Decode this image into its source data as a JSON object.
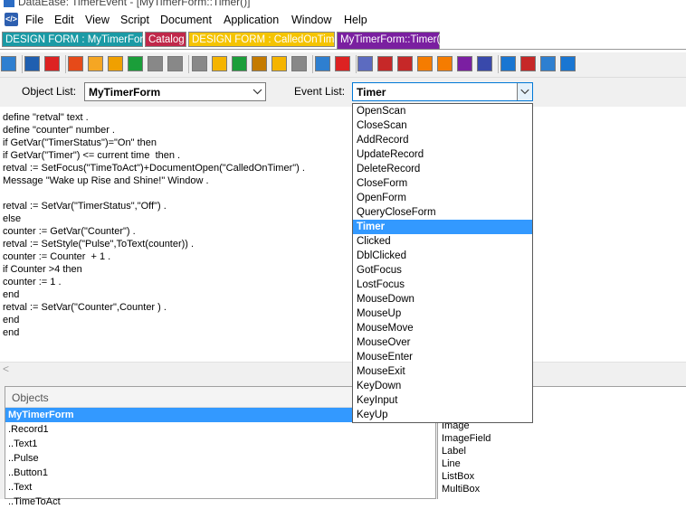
{
  "window": {
    "title": "DataEase: TimerEvent - [MyTimerForm::Timer()]"
  },
  "menu": [
    "File",
    "Edit",
    "View",
    "Script",
    "Document",
    "Application",
    "Window",
    "Help"
  ],
  "doc_tabs": [
    {
      "label": "DESIGN FORM : MyTimerForm",
      "bg": "#1a9aa5",
      "fg": "#ffffff"
    },
    {
      "label": "Catalog",
      "bg": "#c0284a",
      "fg": "#ffffff"
    },
    {
      "label": "DESIGN FORM : CalledOnTimer",
      "bg": "#f5c400",
      "fg": "#ffffff"
    },
    {
      "label": "MyTimerForm::Timer()",
      "bg": "#7a1fa0",
      "fg": "#ffffff"
    }
  ],
  "toolbar_icons": [
    "design-icon",
    "pointer-icon",
    "save-icon",
    "settings-icon",
    "cut-icon",
    "copy-icon",
    "paste-icon",
    "undo-icon",
    "redo-icon",
    "first-record-icon",
    "prev-record-icon",
    "find-icon",
    "edit-icon",
    "next-record-icon",
    "last-record-icon",
    "form-view-icon",
    "delete-icon",
    "table-view-icon",
    "record-view-icon",
    "multi-form-icon",
    "column-icon",
    "grid-icon",
    "import-icon",
    "export-icon",
    "users-icon",
    "security-icon",
    "relations-icon",
    "config-icon"
  ],
  "selectors": {
    "object_list_label": "Object List:",
    "object_list_value": "MyTimerForm",
    "event_list_label": "Event List:",
    "event_list_value": "Timer"
  },
  "code_lines": [
    "define \"retval\" text .",
    "define \"counter\" number .",
    "if GetVar(\"TimerStatus\")=\"On\" then",
    "if GetVar(\"Timer\") <= current time  then .",
    "retval := SetFocus(\"TimeToAct\")+DocumentOpen(\"CalledOnTimer\") .",
    "Message \"Wake up Rise and Shine!\" Window .",
    "",
    "retval := SetVar(\"TimerStatus\",\"Off\") .",
    "else",
    "counter := GetVar(\"Counter\") .",
    "retval := SetStyle(\"Pulse\",ToText(counter)) .",
    "counter := Counter  + 1 .",
    "if Counter >4 then",
    "counter := 1 .",
    "end",
    "retval := SetVar(\"Counter\",Counter ) .",
    "end",
    "end"
  ],
  "event_options": [
    "OpenScan",
    "CloseScan",
    "AddRecord",
    "UpdateRecord",
    "DeleteRecord",
    "CloseForm",
    "OpenForm",
    "QueryCloseForm",
    "Timer",
    "Clicked",
    "DblClicked",
    "GotFocus",
    "LostFocus",
    "MouseDown",
    "MouseUp",
    "MouseMove",
    "MouseOver",
    "MouseEnter",
    "MouseExit",
    "KeyDown",
    "KeyInput",
    "KeyUp"
  ],
  "selected_event": "Timer",
  "objects_panel": {
    "title": "Objects",
    "items": [
      "MyTimerForm",
      ".Record1",
      "..Text1",
      "..Pulse",
      "..Button1",
      "..Text",
      "..TimeToAct"
    ]
  },
  "controls_list": [
    "Image",
    "ImageField",
    "Label",
    "Line",
    "ListBox",
    "MultiBox"
  ],
  "colors": {
    "selection": "#3399ff",
    "toolbar_bg": "#f0f0f0"
  }
}
